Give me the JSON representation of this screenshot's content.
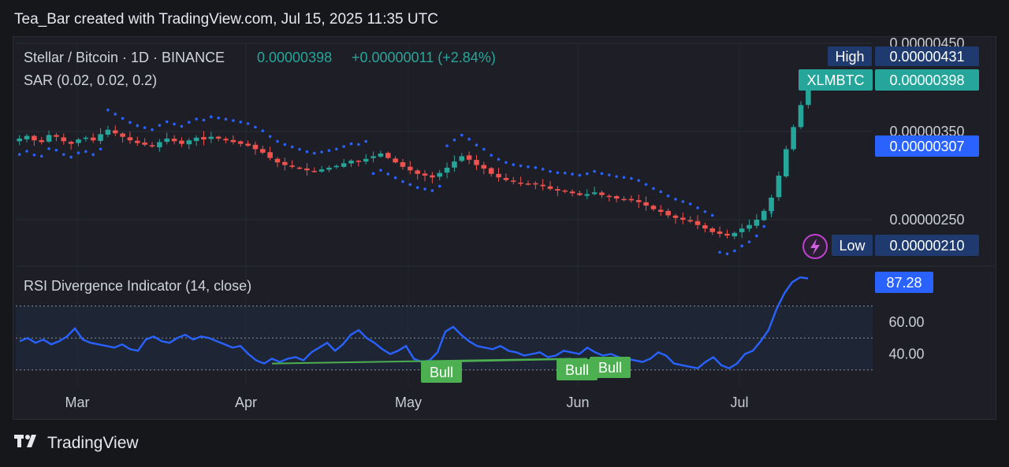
{
  "header": {
    "attribution": "Tea_Bar created with TradingView.com, Jul 15, 2025 11:35 UTC"
  },
  "legend": {
    "symbol": "Stellar / Bitcoin · 1D · BINANCE",
    "last": "0.00000398",
    "change": "+0.00000011 (+2.84%)",
    "sar": "SAR (0.02, 0.02, 0.2)",
    "rsi": "RSI Divergence Indicator (14, close)"
  },
  "labels": {
    "high": "High",
    "high_value": "0.00000431",
    "ticker": "XLMBTC",
    "ticker_value": "0.00000398",
    "sar_value": "0.00000307",
    "low": "Low",
    "low_value": "0.00000210",
    "rsi_value": "87.28",
    "bull": "Bull"
  },
  "footer": {
    "brand": "TradingView"
  },
  "colors": {
    "up": "#26a69a",
    "down": "#ef5350",
    "sar": "#2962ff",
    "rsi": "#2962ff",
    "bull": "#4caf50",
    "ticker_bg": "#26a69a",
    "badge_bg": "#1e3a6e",
    "sar_badge_bg": "#2962ff"
  },
  "chart_data": [
    {
      "type": "candlestick",
      "title": "Stellar / Bitcoin · 1D · BINANCE",
      "x_tick_labels": [
        "Mar",
        "Apr",
        "May",
        "Jun",
        "Jul"
      ],
      "y_tick_labels": [
        "0.00000450",
        "0.00000350",
        "0.00000250"
      ],
      "ylim": [
        2e-06,
        4.5e-06
      ],
      "close_series": [
        3.42,
        3.45,
        3.4,
        3.38,
        3.46,
        3.44,
        3.39,
        3.36,
        3.41,
        3.43,
        3.4,
        3.47,
        3.52,
        3.48,
        3.44,
        3.4,
        3.37,
        3.35,
        3.33,
        3.38,
        3.42,
        3.39,
        3.36,
        3.4,
        3.43,
        3.41,
        3.44,
        3.42,
        3.4,
        3.38,
        3.36,
        3.34,
        3.3,
        3.26,
        3.2,
        3.15,
        3.12,
        3.1,
        3.08,
        3.06,
        3.05,
        3.07,
        3.09,
        3.11,
        3.14,
        3.17,
        3.16,
        3.19,
        3.22,
        3.25,
        3.2,
        3.15,
        3.1,
        3.06,
        3.02,
        3.0,
        2.98,
        3.03,
        3.09,
        3.16,
        3.22,
        3.18,
        3.12,
        3.08,
        3.02,
        2.98,
        2.95,
        2.93,
        2.92,
        2.91,
        2.9,
        2.88,
        2.85,
        2.83,
        2.82,
        2.8,
        2.78,
        2.79,
        2.81,
        2.78,
        2.76,
        2.74,
        2.73,
        2.72,
        2.7,
        2.66,
        2.62,
        2.59,
        2.55,
        2.52,
        2.5,
        2.48,
        2.44,
        2.4,
        2.36,
        2.34,
        2.32,
        2.35,
        2.4,
        2.44,
        2.5,
        2.6,
        2.75,
        3.0,
        3.3,
        3.55,
        3.8,
        3.98
      ],
      "parabolic_sar": {
        "name": "SAR (0.02, 0.02, 0.2)",
        "last_value": 3.07e-06
      },
      "high": 4.31e-06,
      "low": 2.1e-06,
      "last": 3.98e-06
    },
    {
      "type": "line",
      "title": "RSI Divergence Indicator (14, close)",
      "y_tick_labels": [
        "60.00",
        "40.00"
      ],
      "ylim": [
        20,
        95
      ],
      "bands": [
        30,
        50,
        70
      ],
      "values": [
        48,
        50,
        47,
        49,
        46,
        48,
        51,
        56,
        49,
        47,
        46,
        45,
        44,
        46,
        43,
        42,
        49,
        51,
        48,
        47,
        50,
        52,
        49,
        51,
        50,
        48,
        46,
        44,
        45,
        40,
        36,
        34,
        37,
        35,
        37,
        38,
        36,
        41,
        44,
        47,
        42,
        46,
        52,
        55,
        50,
        47,
        43,
        40,
        42,
        45,
        37,
        35,
        36,
        41,
        54,
        57,
        52,
        48,
        45,
        44,
        43,
        45,
        42,
        41,
        39,
        40,
        41,
        38,
        39,
        42,
        41,
        40,
        44,
        41,
        39,
        40,
        38,
        37,
        36,
        35,
        37,
        41,
        39,
        34,
        33,
        32,
        31,
        35,
        38,
        33,
        31,
        34,
        40,
        42,
        48,
        55,
        68,
        78,
        85,
        88,
        87.28
      ],
      "last_value": 87.28,
      "annotations": [
        "Bull",
        "Bull",
        "Bull"
      ]
    }
  ]
}
